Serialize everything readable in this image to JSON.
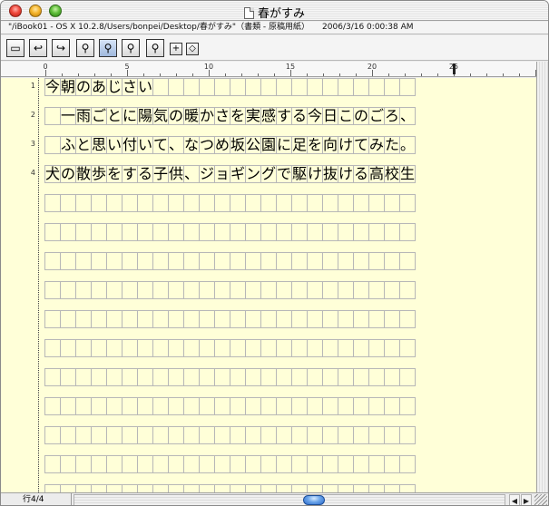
{
  "window": {
    "title": "春がすみ"
  },
  "info_bar": {
    "path": "\"/iBook01 - OS X 10.2.8/Users/bonpei/Desktop/春がすみ\"（書類 - 原稿用紙）",
    "timestamp": "2006/3/16  0:00:38 AM"
  },
  "toolbar": {
    "buttons": [
      {
        "icon": "save-icon",
        "glyph": "▭"
      },
      {
        "icon": "undo-icon",
        "glyph": "↩"
      },
      {
        "icon": "redo-icon",
        "glyph": "↪"
      },
      {
        "icon": "find-icon",
        "glyph": "⚲"
      },
      {
        "icon": "find-replace-icon",
        "glyph": "⚲"
      },
      {
        "icon": "find-next-icon",
        "glyph": "⚲"
      },
      {
        "icon": "find-previous-icon",
        "glyph": "⚲"
      },
      {
        "icon": "plus-icon",
        "glyph": "+"
      },
      {
        "icon": "diamond-icon",
        "glyph": "◇"
      }
    ]
  },
  "ruler": {
    "labels": [
      "0",
      "5",
      "10",
      "15",
      "20",
      "25"
    ]
  },
  "document": {
    "line_numbers": [
      "1",
      "2",
      "3",
      "4"
    ],
    "lines": [
      "今朝のあじさい",
      "　一雨ごとに陽気の暖かさを実感する今日このごろ、",
      "　ふと思い付いて、なつめ坂公園に足を向けてみた。",
      "犬の散歩をする子供、ジョギングで駆け抜ける高校生、"
    ],
    "empty_rows": 11
  },
  "status": {
    "line_indicator": "行4/4"
  },
  "colors": {
    "paper": "#ffffd8",
    "grid": "#b7b7b7",
    "scroll_thumb": "#2c6ac9"
  }
}
